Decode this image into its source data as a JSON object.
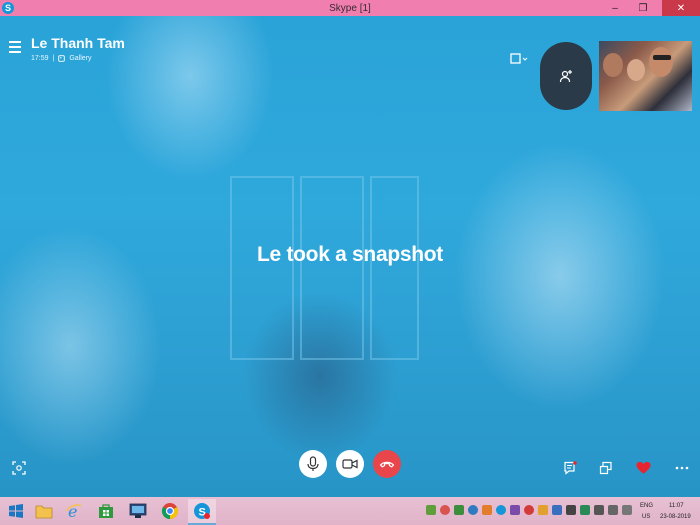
{
  "window": {
    "title": "Skype [1]"
  },
  "call": {
    "contact_name": "Le Thanh Tam",
    "time": "17:59",
    "gallery_label": "Gallery",
    "snapshot_message": "Le took a snapshot"
  },
  "taskbar": {
    "language": "ENG",
    "region": "US",
    "time": "11:07",
    "date": "23-08-2019"
  },
  "colors": {
    "title_bar": "#f07fb0",
    "end_call": "#e8464a",
    "heart": "#e8252f",
    "add_person_bg": "#2a3a48"
  }
}
